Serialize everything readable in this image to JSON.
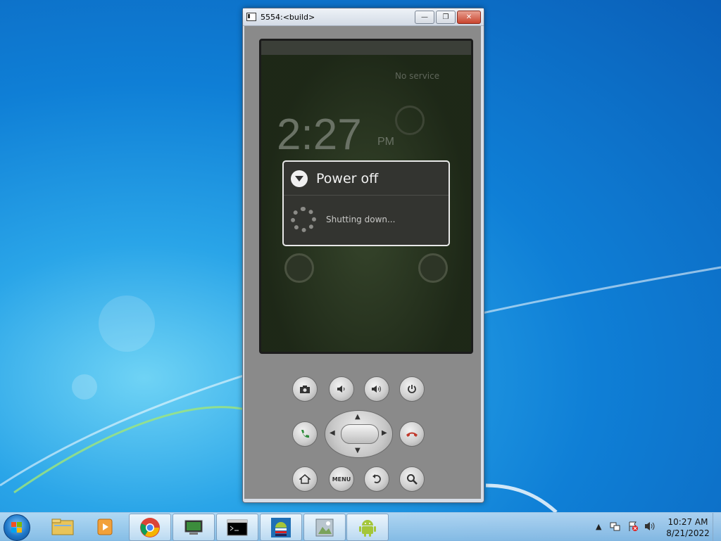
{
  "window": {
    "title": "5554:<build>",
    "minimize_label": "—",
    "restore_label": "❐",
    "close_label": "✕"
  },
  "lockscreen": {
    "time": "2:27",
    "ampm": "PM",
    "service": "No service"
  },
  "dialog": {
    "title": "Power off",
    "message": "Shutting down..."
  },
  "controls": {
    "menu_label": "MENU"
  },
  "taskbar": {
    "time": "10:27 AM",
    "date": "8/21/2022",
    "items": [
      "windows-explorer",
      "windows-media-player",
      "google-chrome",
      "system-manager",
      "command-prompt",
      "sdk-manager",
      "avd-manager",
      "android-emulator"
    ]
  },
  "colors": {
    "accent": "#1f78c8",
    "call": "#2e8b3a",
    "hangup": "#c0392b"
  }
}
